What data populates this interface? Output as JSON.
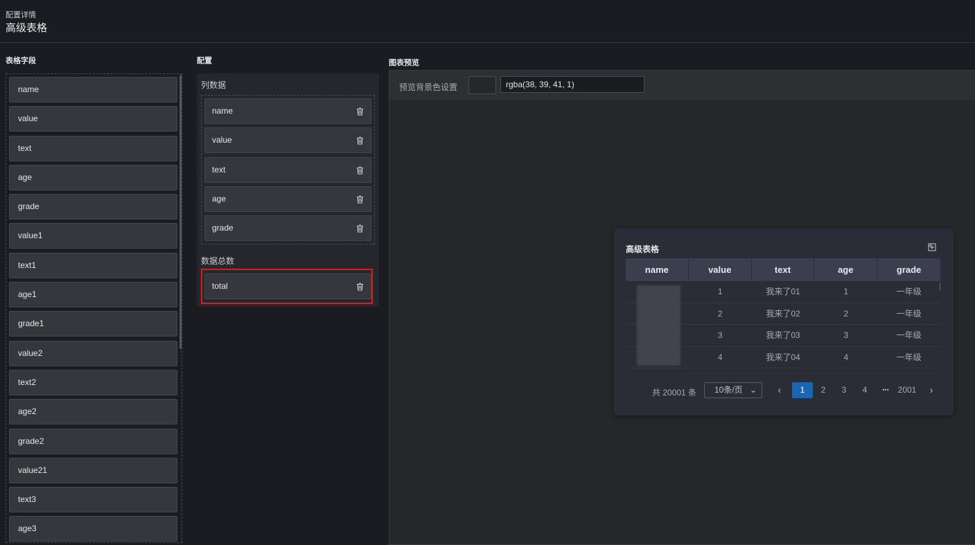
{
  "header": {
    "breadcrumb": "配置详情",
    "title": "高级表格"
  },
  "fields": {
    "title": "表格字段",
    "items": [
      "name",
      "value",
      "text",
      "age",
      "grade",
      "value1",
      "text1",
      "age1",
      "grade1",
      "value2",
      "text2",
      "age2",
      "grade2",
      "value21",
      "text3",
      "age3"
    ]
  },
  "config": {
    "title": "配置",
    "columns_title": "列数据",
    "columns": [
      "name",
      "value",
      "text",
      "age",
      "grade"
    ],
    "total_title": "数据总数",
    "total_item": "total"
  },
  "preview": {
    "title": "图表预览",
    "bg_label": "预览背景色设置",
    "bg_value": "rgba(38, 39, 41, 1)"
  },
  "table_card": {
    "title": "高级表格",
    "headers": [
      "name",
      "value",
      "text",
      "age",
      "grade"
    ],
    "rows": [
      [
        "",
        "1",
        "我来了01",
        "1",
        "一年级"
      ],
      [
        "",
        "2",
        "我来了02",
        "2",
        "一年级"
      ],
      [
        "",
        "3",
        "我来了03",
        "3",
        "一年级"
      ],
      [
        "",
        "4",
        "我来了04",
        "4",
        "一年级"
      ]
    ],
    "pagination": {
      "total": "共 20001 条",
      "page_size": "10条/页",
      "pages": [
        "1",
        "2",
        "3",
        "4"
      ],
      "ellipsis": "•••",
      "last": "2001",
      "current": "1"
    }
  },
  "colors": {
    "background": "#1b1c22",
    "accent": "#1a66b3",
    "highlight": "#e01b1b"
  }
}
